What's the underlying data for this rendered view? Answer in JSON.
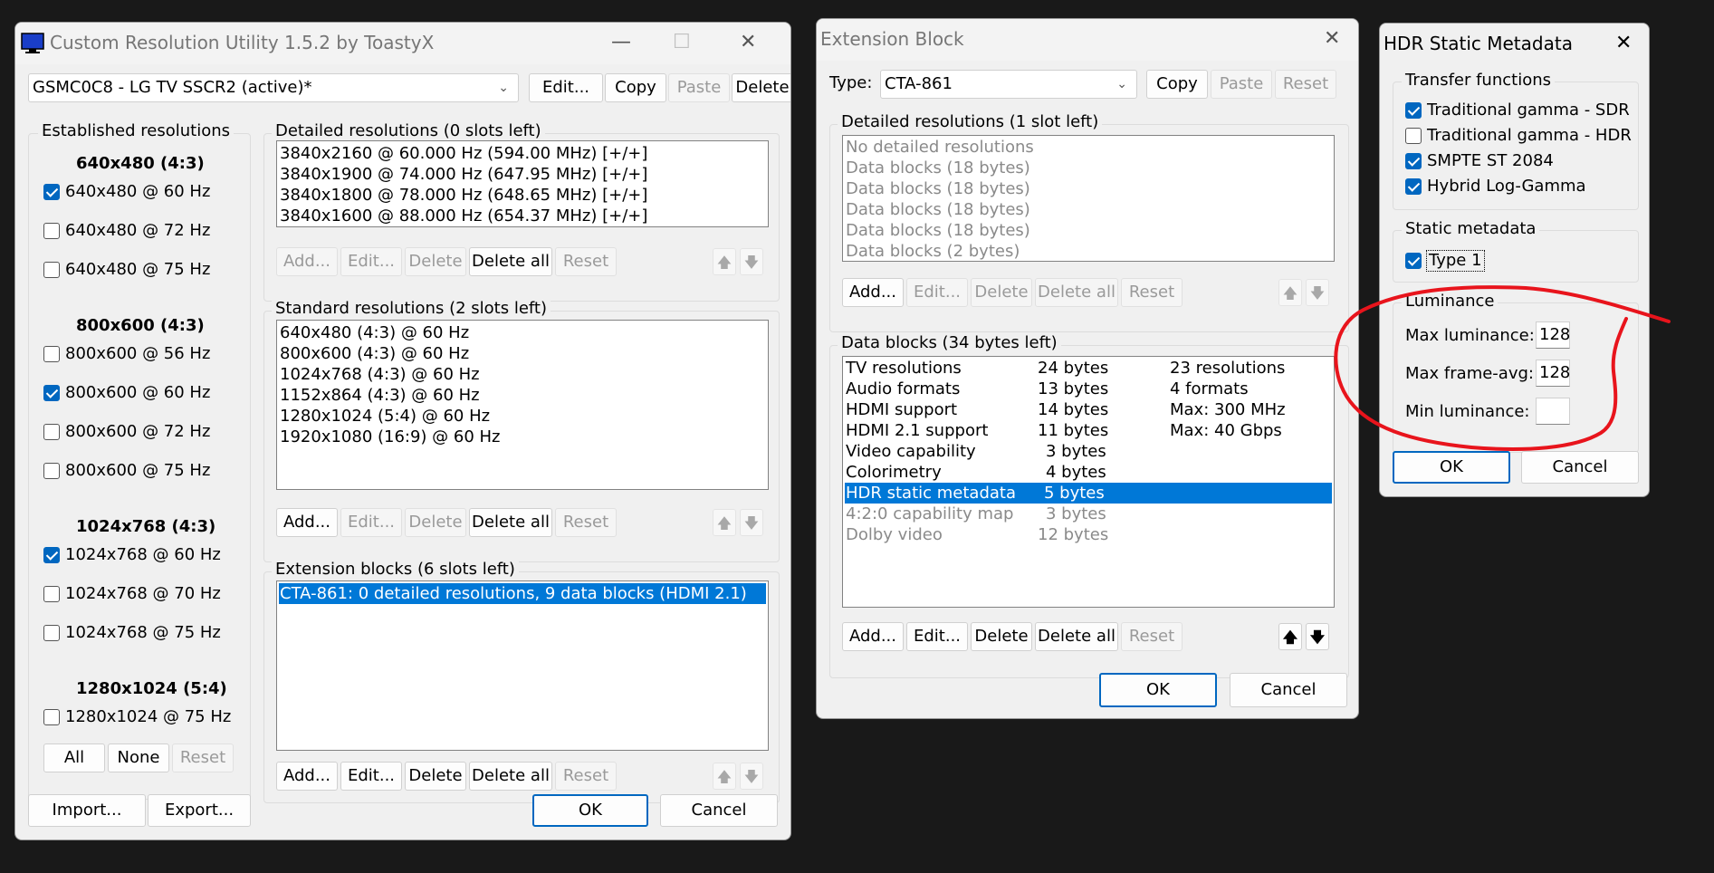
{
  "cru": {
    "title": "Custom Resolution Utility 1.5.2 by ToastyX",
    "monitor": "GSMC0C8 - LG TV SSCR2 (active)*",
    "top_buttons": [
      "Edit...",
      "Copy",
      "Paste",
      "Delete"
    ],
    "established": {
      "label": "Established resolutions",
      "groups": [
        {
          "heading": "640x480 (4:3)",
          "items": [
            {
              "label": "640x480 @ 60 Hz",
              "checked": true
            },
            {
              "label": "640x480 @ 72 Hz",
              "checked": false
            },
            {
              "label": "640x480 @ 75 Hz",
              "checked": false
            }
          ]
        },
        {
          "heading": "800x600 (4:3)",
          "items": [
            {
              "label": "800x600 @ 56 Hz",
              "checked": false
            },
            {
              "label": "800x600 @ 60 Hz",
              "checked": true
            },
            {
              "label": "800x600 @ 72 Hz",
              "checked": false
            },
            {
              "label": "800x600 @ 75 Hz",
              "checked": false
            }
          ]
        },
        {
          "heading": "1024x768 (4:3)",
          "items": [
            {
              "label": "1024x768 @ 60 Hz",
              "checked": true
            },
            {
              "label": "1024x768 @ 70 Hz",
              "checked": false
            },
            {
              "label": "1024x768 @ 75 Hz",
              "checked": false
            }
          ]
        },
        {
          "heading": "1280x1024 (5:4)",
          "items": [
            {
              "label": "1280x1024 @ 75 Hz",
              "checked": false
            }
          ]
        }
      ],
      "buttons": [
        "All",
        "None",
        "Reset"
      ]
    },
    "detailed": {
      "label": "Detailed resolutions (0 slots left)",
      "items": [
        "3840x2160 @ 60.000 Hz (594.00 MHz) [+/+]",
        "3840x1900 @ 74.000 Hz (647.95 MHz) [+/+]",
        "3840x1800 @ 78.000 Hz (648.65 MHz) [+/+]",
        "3840x1600 @ 88.000 Hz (654.37 MHz) [+/+]"
      ],
      "buttons": [
        "Add...",
        "Edit...",
        "Delete",
        "Delete all",
        "Reset"
      ]
    },
    "standard": {
      "label": "Standard resolutions (2 slots left)",
      "items": [
        "640x480 (4:3) @ 60 Hz",
        "800x600 (4:3) @ 60 Hz",
        "1024x768 (4:3) @ 60 Hz",
        "1152x864 (4:3) @ 60 Hz",
        "1280x1024 (5:4) @ 60 Hz",
        "1920x1080 (16:9) @ 60 Hz"
      ],
      "buttons": [
        "Add...",
        "Edit...",
        "Delete",
        "Delete all",
        "Reset"
      ]
    },
    "extension": {
      "label": "Extension blocks (6 slots left)",
      "items": [
        "CTA-861: 0 detailed resolutions, 9 data blocks (HDMI 2.1)"
      ],
      "buttons": [
        "Add...",
        "Edit...",
        "Delete",
        "Delete all",
        "Reset"
      ]
    },
    "import": "Import...",
    "export": "Export...",
    "ok": "OK",
    "cancel": "Cancel"
  },
  "ext": {
    "title": "Extension Block",
    "type_label": "Type:",
    "type_value": "CTA-861",
    "type_buttons": [
      "Copy",
      "Paste",
      "Reset"
    ],
    "detailed": {
      "label": "Detailed resolutions (1 slot left)",
      "items": [
        "No detailed resolutions",
        "Data blocks (18 bytes)",
        "Data blocks (18 bytes)",
        "Data blocks (18 bytes)",
        "Data blocks (18 bytes)",
        "Data blocks (2 bytes)"
      ],
      "buttons": [
        "Add...",
        "Edit...",
        "Delete",
        "Delete all",
        "Reset"
      ]
    },
    "datablocks": {
      "label": "Data blocks (34 bytes left)",
      "rows": [
        {
          "name": "TV resolutions",
          "size": "24 bytes",
          "info": "23 resolutions"
        },
        {
          "name": "Audio formats",
          "size": "13 bytes",
          "info": "4 formats"
        },
        {
          "name": "HDMI support",
          "size": "14 bytes",
          "info": "Max: 300 MHz"
        },
        {
          "name": "HDMI 2.1 support",
          "size": "11 bytes",
          "info": "Max: 40 Gbps"
        },
        {
          "name": "Video capability",
          "size": "3 bytes",
          "info": ""
        },
        {
          "name": "Colorimetry",
          "size": "4 bytes",
          "info": ""
        },
        {
          "name": "HDR static metadata",
          "size": "5 bytes",
          "info": ""
        },
        {
          "name": "4:2:0 capability map",
          "size": "3 bytes",
          "info": ""
        },
        {
          "name": "Dolby video",
          "size": "12 bytes",
          "info": ""
        }
      ],
      "buttons": [
        "Add...",
        "Edit...",
        "Delete",
        "Delete all",
        "Reset"
      ]
    },
    "ok": "OK",
    "cancel": "Cancel"
  },
  "hdr": {
    "title": "HDR Static Metadata",
    "transfer_label": "Transfer functions",
    "transfer": [
      {
        "label": "Traditional gamma - SDR",
        "checked": true
      },
      {
        "label": "Traditional gamma - HDR",
        "checked": false
      },
      {
        "label": "SMPTE ST 2084",
        "checked": true
      },
      {
        "label": "Hybrid Log-Gamma",
        "checked": true
      }
    ],
    "static_label": "Static metadata",
    "static_type": {
      "label": "Type 1",
      "checked": true
    },
    "lum_label": "Luminance",
    "max_lum_label": "Max luminance:",
    "max_lum": "128",
    "max_frame_label": "Max frame-avg:",
    "max_frame": "128",
    "min_lum_label": "Min luminance:",
    "min_lum": "",
    "ok": "OK",
    "cancel": "Cancel"
  },
  "colors": {
    "selection": "#0078d7",
    "annotation": "#e8141c",
    "accent": "#0067c0"
  }
}
